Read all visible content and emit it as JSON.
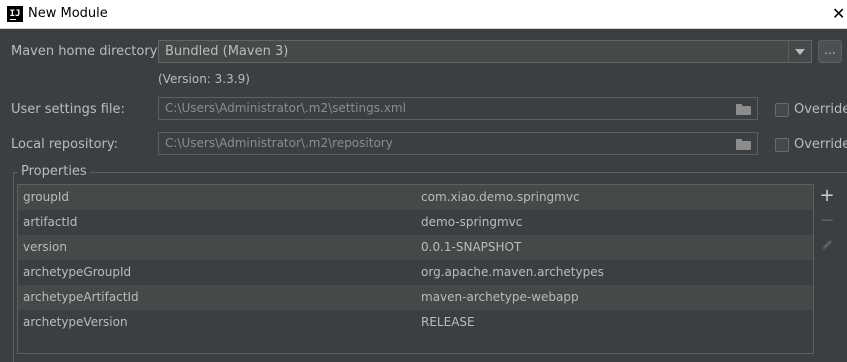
{
  "window": {
    "title": "New Module",
    "app_icon_text": "IJ",
    "close_glyph": "✕"
  },
  "maven": {
    "home_label": "Maven home directory:",
    "home_value": "Bundled (Maven 3)",
    "browse_label": "...",
    "version_text": "(Version: 3.3.9)"
  },
  "settings": {
    "label": "User settings file:",
    "value": "C:\\Users\\Administrator\\.m2\\settings.xml",
    "override_label": "Override",
    "override_checked": false
  },
  "repository": {
    "label": "Local repository:",
    "value": "C:\\Users\\Administrator\\.m2\\repository",
    "override_label": "Override",
    "override_checked": false
  },
  "properties": {
    "title": "Properties",
    "rows": [
      {
        "key": "groupId",
        "value": "com.xiao.demo.springmvc"
      },
      {
        "key": "artifactId",
        "value": "demo-springmvc"
      },
      {
        "key": "version",
        "value": "0.0.1-SNAPSHOT"
      },
      {
        "key": "archetypeGroupId",
        "value": "org.apache.maven.archetypes"
      },
      {
        "key": "archetypeArtifactId",
        "value": "maven-archetype-webapp"
      },
      {
        "key": "archetypeVersion",
        "value": "RELEASE"
      }
    ],
    "add_glyph": "+",
    "remove_glyph": "−"
  },
  "icons": {
    "app": "intellij-logo-icon",
    "close": "close-icon",
    "dropdown": "chevron-down-icon",
    "folder": "folder-icon",
    "add": "plus-icon",
    "remove": "minus-icon",
    "edit": "pencil-icon"
  },
  "colors": {
    "background": "#3c3f41",
    "text": "#bbbbbb",
    "alt_row": "#45494a",
    "border": "#5e6060"
  }
}
